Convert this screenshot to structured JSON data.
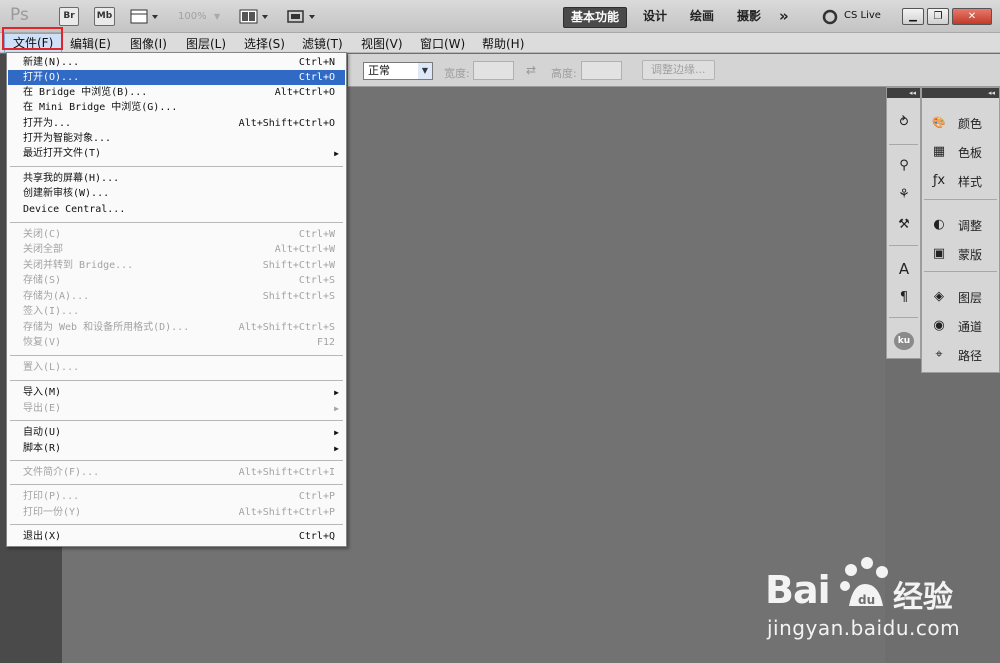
{
  "appbar": {
    "logo": "Ps",
    "bridge_label": "Br",
    "minibridge_label": "Mb",
    "zoom": "100%",
    "workspaces": [
      "基本功能",
      "设计",
      "绘画",
      "摄影"
    ],
    "more": "»",
    "cs_live": "CS Live",
    "window_controls": [
      "minimize-icon",
      "restore-icon",
      "close-icon"
    ]
  },
  "menubar": [
    "文件(F)",
    "编辑(E)",
    "图像(I)",
    "图层(L)",
    "选择(S)",
    "滤镜(T)",
    "视图(V)",
    "窗口(W)",
    "帮助(H)"
  ],
  "options": {
    "mode": "正常",
    "width_label": "宽度:",
    "height_label": "高度:",
    "refine_button": "调整边缘..."
  },
  "file_menu": {
    "groups": [
      [
        {
          "label": "新建(N)...",
          "shortcut": "Ctrl+N"
        },
        {
          "label": "打开(O)...",
          "shortcut": "Ctrl+O",
          "highlight": true
        },
        {
          "label": "在 Bridge 中浏览(B)...",
          "shortcut": "Alt+Ctrl+O"
        },
        {
          "label": "在 Mini Bridge 中浏览(G)...",
          "shortcut": ""
        },
        {
          "label": "打开为...",
          "shortcut": "Alt+Shift+Ctrl+O"
        },
        {
          "label": "打开为智能对象...",
          "shortcut": ""
        },
        {
          "label": "最近打开文件(T)",
          "shortcut": "",
          "submenu": true
        }
      ],
      [
        {
          "label": "共享我的屏幕(H)...",
          "shortcut": ""
        },
        {
          "label": "创建新审核(W)...",
          "shortcut": ""
        },
        {
          "label": "Device Central...",
          "shortcut": ""
        }
      ],
      [
        {
          "label": "关闭(C)",
          "shortcut": "Ctrl+W",
          "disabled": true
        },
        {
          "label": "关闭全部",
          "shortcut": "Alt+Ctrl+W",
          "disabled": true
        },
        {
          "label": "关闭并转到 Bridge...",
          "shortcut": "Shift+Ctrl+W",
          "disabled": true
        },
        {
          "label": "存储(S)",
          "shortcut": "Ctrl+S",
          "disabled": true
        },
        {
          "label": "存储为(A)...",
          "shortcut": "Shift+Ctrl+S",
          "disabled": true
        },
        {
          "label": "签入(I)...",
          "shortcut": "",
          "disabled": true
        },
        {
          "label": "存储为 Web 和设备所用格式(D)...",
          "shortcut": "Alt+Shift+Ctrl+S",
          "disabled": true
        },
        {
          "label": "恢复(V)",
          "shortcut": "F12",
          "disabled": true
        }
      ],
      [
        {
          "label": "置入(L)...",
          "shortcut": "",
          "disabled": true
        }
      ],
      [
        {
          "label": "导入(M)",
          "shortcut": "",
          "submenu": true
        },
        {
          "label": "导出(E)",
          "shortcut": "",
          "submenu": true,
          "disabled": true
        }
      ],
      [
        {
          "label": "自动(U)",
          "shortcut": "",
          "submenu": true
        },
        {
          "label": "脚本(R)",
          "shortcut": "",
          "submenu": true
        }
      ],
      [
        {
          "label": "文件简介(F)...",
          "shortcut": "Alt+Shift+Ctrl+I",
          "disabled": true
        }
      ],
      [
        {
          "label": "打印(P)...",
          "shortcut": "Ctrl+P",
          "disabled": true
        },
        {
          "label": "打印一份(Y)",
          "shortcut": "Alt+Shift+Ctrl+P",
          "disabled": true
        }
      ],
      [
        {
          "label": "退出(X)",
          "shortcut": "Ctrl+Q"
        }
      ]
    ]
  },
  "panels": {
    "collapse_arrows": "◂◂",
    "items": [
      {
        "label": "颜色",
        "icon": "palette-icon"
      },
      {
        "label": "色板",
        "icon": "swatches-grid-icon"
      },
      {
        "label": "样式",
        "icon": "fx-style-icon"
      },
      {
        "label": "调整",
        "icon": "adjustment-icon"
      },
      {
        "label": "蒙版",
        "icon": "mask-icon"
      },
      {
        "label": "图层",
        "icon": "layers-icon"
      },
      {
        "label": "通道",
        "icon": "channels-icon"
      },
      {
        "label": "路径",
        "icon": "path-icon"
      }
    ],
    "narrow_icons": [
      "history-icon",
      "brush-presets-icon",
      "clone-source-icon",
      "tool-presets-icon",
      "character-icon",
      "paragraph-icon",
      "kuler-icon"
    ],
    "kuler": "ku"
  },
  "watermark": {
    "brand": "Bai",
    "brand_cn": "经验",
    "url": "jingyan.baidu.com"
  },
  "colors": {
    "highlight": "#316ac5",
    "annotation_red": "#e0262b",
    "workspace_background": "#727272"
  }
}
